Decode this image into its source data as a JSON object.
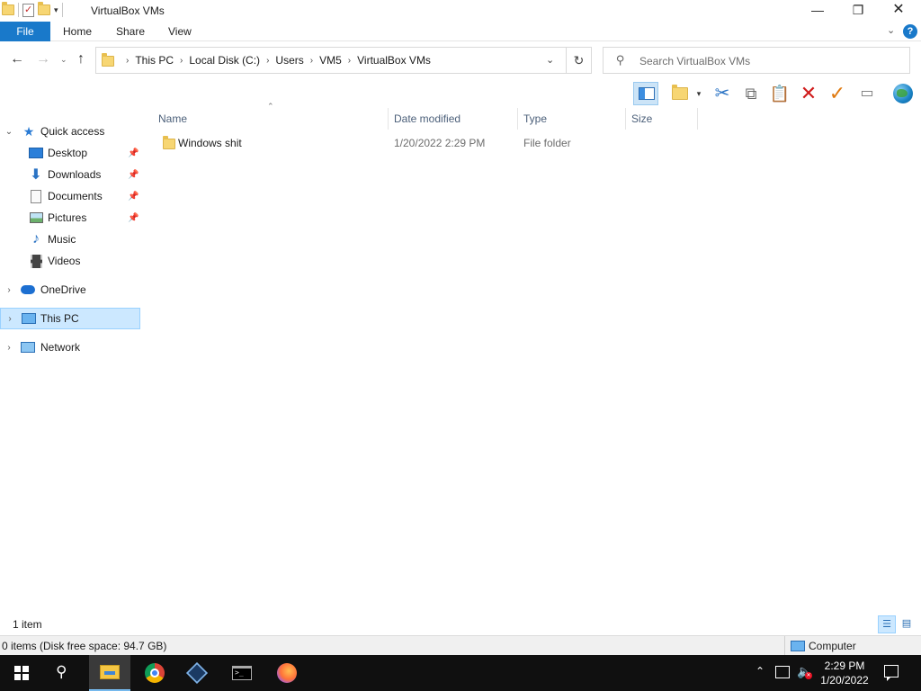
{
  "window": {
    "title": "VirtualBox VMs",
    "minimize_glyph": "—",
    "maximize_glyph": "❐",
    "close_glyph": "✕"
  },
  "ribbon": {
    "tabs": [
      {
        "label": "File"
      },
      {
        "label": "Home"
      },
      {
        "label": "Share"
      },
      {
        "label": "View"
      }
    ],
    "help_glyph": "?"
  },
  "address": {
    "crumbs": [
      "This PC",
      "Local Disk (C:)",
      "Users",
      "VM5",
      "VirtualBox VMs"
    ],
    "search_placeholder": "Search VirtualBox VMs"
  },
  "nav_pane": {
    "quick_access": "Quick access",
    "items": [
      {
        "label": "Desktop",
        "icon": "desktop-icon",
        "pinned": true
      },
      {
        "label": "Downloads",
        "icon": "downloads-icon",
        "pinned": true
      },
      {
        "label": "Documents",
        "icon": "documents-icon",
        "pinned": true
      },
      {
        "label": "Pictures",
        "icon": "pictures-icon",
        "pinned": true
      },
      {
        "label": "Music",
        "icon": "music-icon",
        "pinned": false
      },
      {
        "label": "Videos",
        "icon": "videos-icon",
        "pinned": false
      }
    ],
    "onedrive": "OneDrive",
    "this_pc": "This PC",
    "network": "Network",
    "selected": "This PC"
  },
  "file_list": {
    "columns": [
      "Name",
      "Date modified",
      "Type",
      "Size"
    ],
    "rows": [
      {
        "name": "Windows shit",
        "date_modified": "1/20/2022 2:29 PM",
        "type": "File folder",
        "size": ""
      }
    ]
  },
  "status": {
    "item_count": "1 item",
    "disk_info": "0 items (Disk free space: 94.7 GB)",
    "location": "Computer"
  },
  "taskbar": {
    "time": "2:29 PM",
    "date": "1/20/2022",
    "apps": [
      "file-explorer",
      "chrome",
      "virtualbox",
      "command-prompt",
      "firefox"
    ],
    "active_app": "file-explorer"
  },
  "colors": {
    "accent": "#1979ca",
    "selection": "#cce8ff",
    "taskbar": "#101010"
  }
}
